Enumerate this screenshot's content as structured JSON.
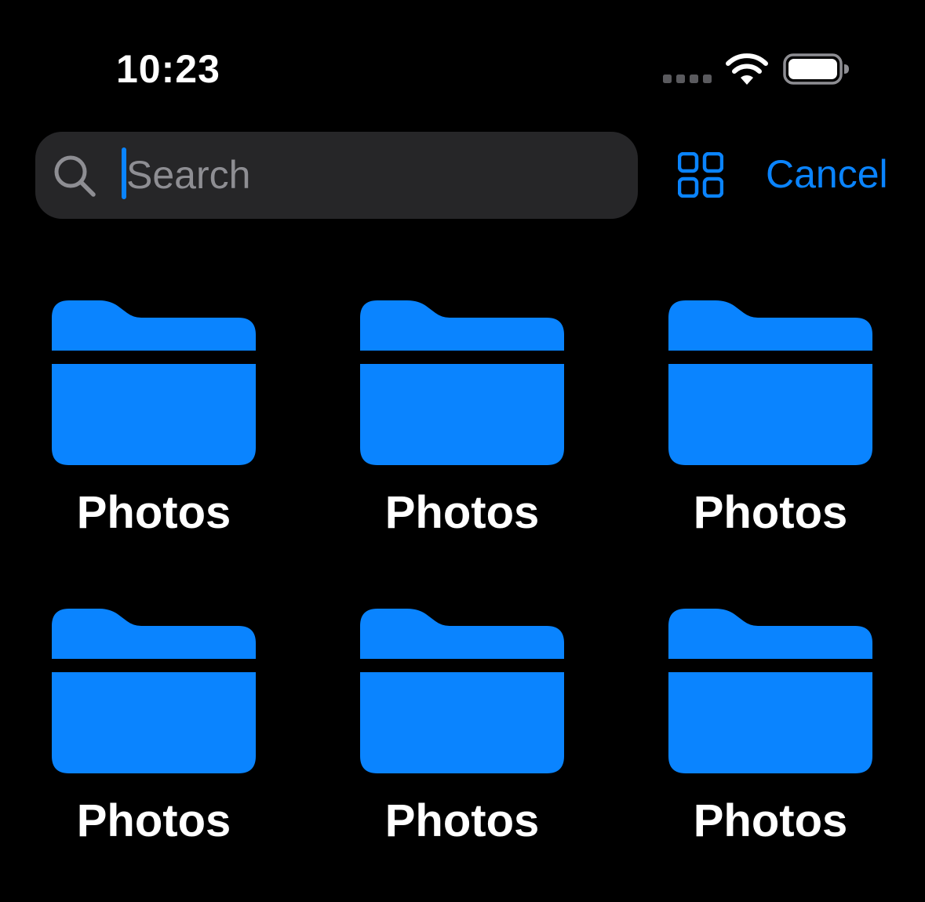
{
  "status_bar": {
    "time": "10:23"
  },
  "search": {
    "placeholder": "Search",
    "value": ""
  },
  "toolbar": {
    "view_toggle_icon": "grid-icon",
    "cancel_label": "Cancel"
  },
  "colors": {
    "accent": "#0a84ff",
    "background": "#000000",
    "search_field": "#262628",
    "placeholder": "#8e8e93"
  },
  "folders": [
    {
      "label": "Photos",
      "icon": "folder-icon"
    },
    {
      "label": "Photos",
      "icon": "folder-icon"
    },
    {
      "label": "Photos",
      "icon": "folder-icon"
    },
    {
      "label": "Photos",
      "icon": "folder-icon"
    },
    {
      "label": "Photos",
      "icon": "folder-icon"
    },
    {
      "label": "Photos",
      "icon": "folder-icon"
    }
  ]
}
